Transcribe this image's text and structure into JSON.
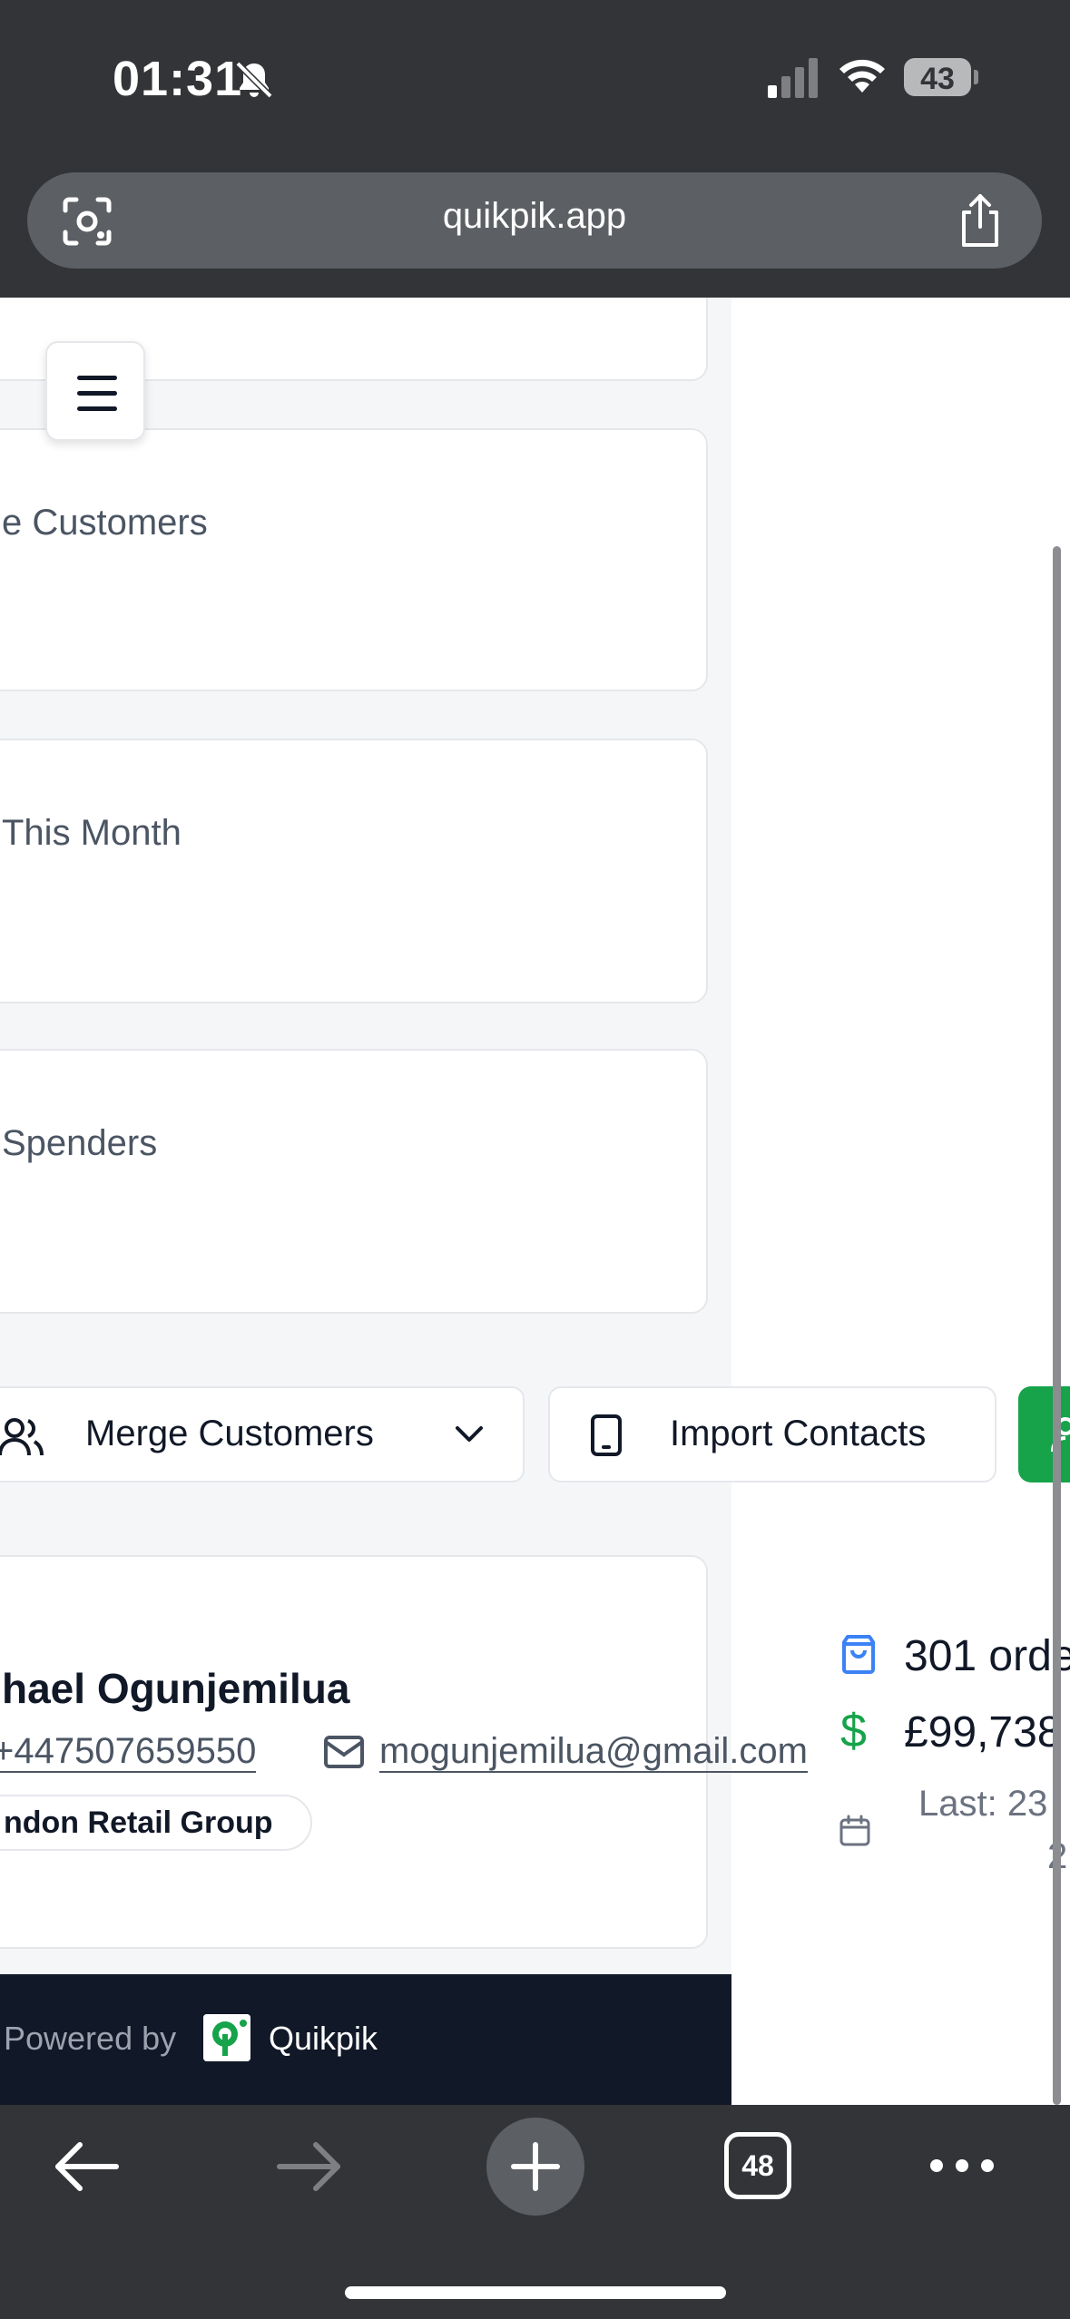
{
  "status_bar": {
    "time": "01:31",
    "battery": "43"
  },
  "browser": {
    "url": "quikpik.app",
    "open_tabs": "48"
  },
  "stat_cards": [
    {
      "label": "e Customers"
    },
    {
      "label": "This Month"
    },
    {
      "label": "Spenders"
    }
  ],
  "actions": {
    "merge_label": "Merge Customers",
    "import_label": "Import Contacts"
  },
  "customer": {
    "name": "hael Ogunjemilua",
    "phone": "+447507659550",
    "email": "mogunjemilua@gmail.com",
    "group": "ndon Retail Group",
    "orders": "301 orde",
    "spent": "£99,738",
    "last_order": "Last: 23",
    "last_order_cont": "2"
  },
  "footer": {
    "powered_by": "Powered by",
    "brand": "Quikpik"
  },
  "colors": {
    "accent_green": "#16a34a",
    "dark_footer": "#111827",
    "browser_chrome": "#323437"
  }
}
